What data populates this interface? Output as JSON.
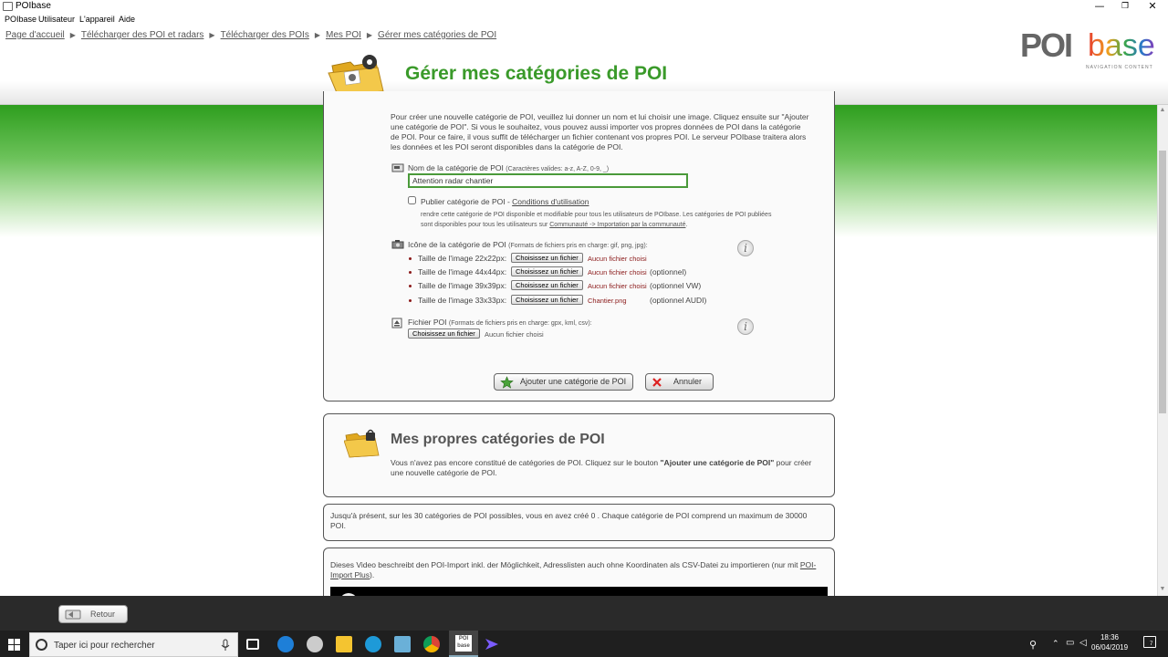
{
  "window": {
    "title": "POIbase",
    "minimize": "—",
    "restore": "❐",
    "close": "✕"
  },
  "menu": [
    "POIbase",
    "Utilisateur",
    "L'appareil",
    "Aide"
  ],
  "breadcrumb": [
    "Page d'accueil",
    "Télécharger des POI et radars",
    "Télécharger des POIs",
    "Mes POI",
    "Gérer mes catégories de POI"
  ],
  "logo": {
    "poi": "POI",
    "base": "base",
    "tagline": "NAVIGATION CONTENT"
  },
  "page_title": "Gérer mes catégories de POI",
  "form": {
    "intro": "Pour créer une nouvelle catégorie de POI, veuillez lui donner un nom et lui choisir une image. Cliquez ensuite sur \"Ajouter une catégorie de POI\". Si vous le souhaitez, vous pouvez aussi importer vos propres données de POI dans la catégorie de POI. Pour ce faire, il vous suffit de télécharger un fichier contenant vos propres POI. Le serveur POIbase traitera alors les données et les POI seront disponibles dans la catégorie de POI.",
    "name_label": "Nom de la catégorie de POI",
    "name_hint": "(Caractères valides: a-z, A-Z, 0-9, _)",
    "name_value": "Attention radar chantier",
    "publish_label": "Publier catégorie de POI - ",
    "publish_link": "Conditions d'utilisation",
    "publish_desc1": "rendre cette catégorie de POI disponible et modifiable pour tous les utilisateurs de POIbase. Les catégories de POI publiées",
    "publish_desc2": "sont disponibles pour tous les utilisateurs sur ",
    "publish_desc_link": "Communauté -> Importation par la communauté",
    "publish_desc_end": ".",
    "icon_label": "Icône de la catégorie de POI",
    "icon_hint": "(Formats de fichiers pris en charge: gif, png, jpg):",
    "icons": [
      {
        "label": "Taille de l'image 22x22px:",
        "button": "Choisissez un fichier",
        "file": "Aucun fichier choisi",
        "note": ""
      },
      {
        "label": "Taille de l'image 44x44px:",
        "button": "Choisissez un fichier",
        "file": "Aucun fichier choisi",
        "note": "(optionnel)"
      },
      {
        "label": "Taille de l'image 39x39px:",
        "button": "Choisissez un fichier",
        "file": "Aucun fichier choisi",
        "note": "(optionnel VW)"
      },
      {
        "label": "Taille de l'image 33x33px:",
        "button": "Choisissez un fichier",
        "file": "Chantier.png",
        "note": "(optionnel AUDI)"
      }
    ],
    "poi_file_label": "Fichier POI",
    "poi_file_hint": "(Formats de fichiers pris en charge: gpx, kml, csv):",
    "poi_file_button": "Choisissez un fichier",
    "poi_file_value": "Aucun fichier choisi",
    "info_glyph": "i",
    "add_button": "Ajouter une catégorie de POI",
    "cancel_button": "Annuler"
  },
  "my_categories": {
    "title": "Mes propres catégories de POI",
    "text_before": "Vous n'avez pas encore constitué de catégories de POI. Cliquez sur le bouton ",
    "text_bold": "\"Ajouter une catégorie de POI\"",
    "text_after": " pour créer une nouvelle catégorie de POI."
  },
  "quota_text": "Jusqu'à présent, sur les 30 catégories de POI possibles, vous en avez créé 0 . Chaque catégorie de POI comprend un maximum de 30000 POI.",
  "video": {
    "text": "Dieses Video beschreibt den POI-Import inkl. der Möglichkeit, Adresslisten auch ohne Koordinaten als CSV-Datei zu importieren (nur mit ",
    "link": "POI-Import Plus",
    "end": ")."
  },
  "footer": {
    "back_button": "Retour"
  },
  "taskbar": {
    "search_placeholder": "Taper ici pour rechercher",
    "time": "18:36",
    "date": "06/04/2019",
    "notifications": "7",
    "app_label": "POI base"
  },
  "colors": {
    "title_green": "#3a9a2a",
    "error_red": "#8b1a1a",
    "accent_green": "#2e9e1e"
  }
}
